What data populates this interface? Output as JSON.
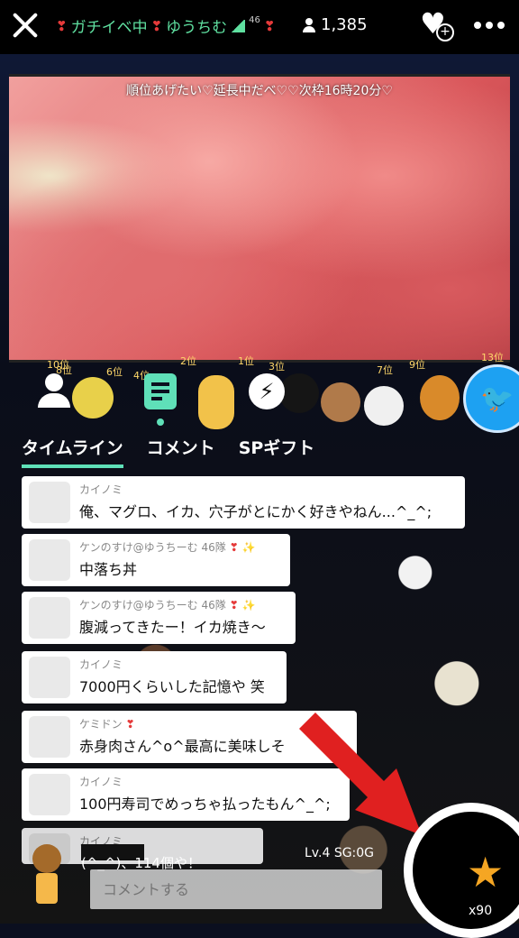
{
  "header": {
    "broadcast_title_prefix": "ガチイベ中",
    "broadcaster_name": "ゆうちむ",
    "level_badge": "46",
    "viewer_count": "1,385"
  },
  "video": {
    "caption": "順位あげたい♡延長中だべ♡♡次枠16時20分♡"
  },
  "ranking_strip": {
    "labels": [
      "10位",
      "8位",
      "6位",
      "4位",
      "2位",
      "1位",
      "3位",
      "7位",
      "9位",
      "13位"
    ]
  },
  "tabs": [
    {
      "label": "タイムライン"
    },
    {
      "label": "コメント"
    },
    {
      "label": "SPギフト"
    }
  ],
  "messages": [
    {
      "name": "カイノミ",
      "text": "俺、マグロ、イカ、穴子がとにかく好きやねん...^_^;"
    },
    {
      "name": "ケンのすけ@ゆうちーむ",
      "name_suffix": "46隊",
      "text": "中落ち丼"
    },
    {
      "name": "ケンのすけ@ゆうちーむ",
      "name_suffix": "46隊",
      "text": "腹減ってきたー！イカ焼き〜"
    },
    {
      "name": "カイノミ",
      "text": "7000円くらいした記憶や  笑"
    },
    {
      "name": "ケミドン",
      "text": "赤身肉さん^o^最高に美味しそ"
    },
    {
      "name": "カイノミ",
      "text": "100円寿司でめっちゃ払ったもん^_^;"
    },
    {
      "name": "カイノミ",
      "text": ""
    }
  ],
  "bottom": {
    "preview_text": "(^_^)、114個や！",
    "level": "Lv.4",
    "sg": "SG:0G",
    "comment_placeholder": "コメントする",
    "star_count": "x90"
  },
  "colors": {
    "accent": "#5fe0b8",
    "heart": "#e53a3a",
    "twitter": "#1da1f2",
    "arrow": "#e02020",
    "star": "#f5a623"
  }
}
